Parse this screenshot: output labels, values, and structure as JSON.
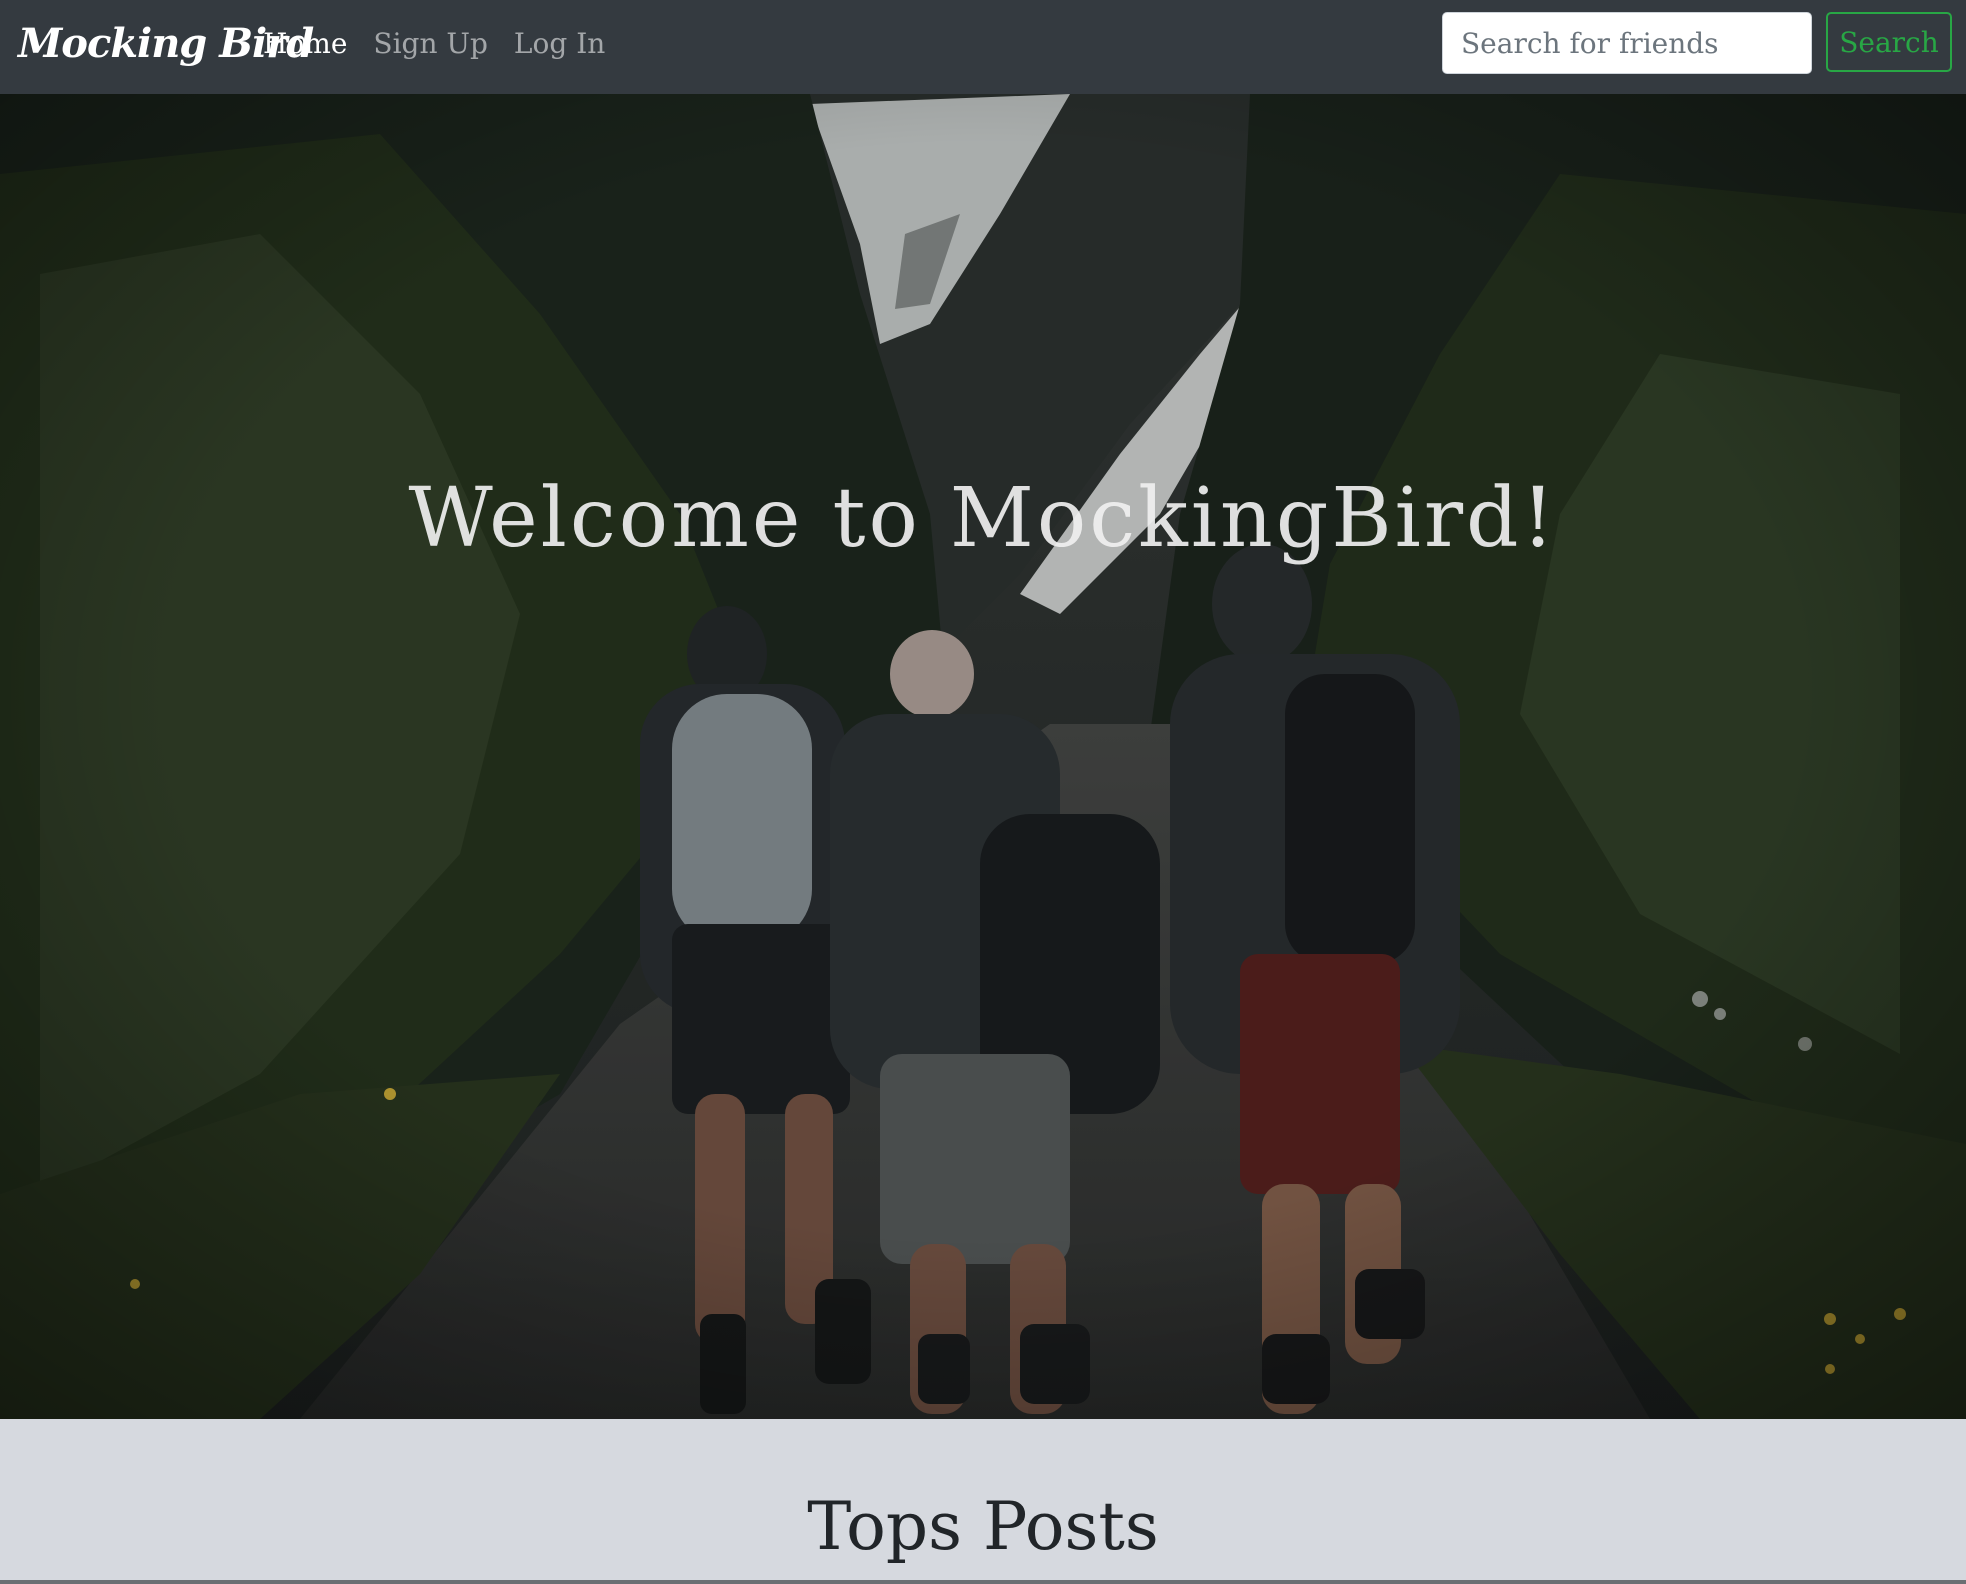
{
  "navbar": {
    "brand": "Mocking Bird",
    "links": [
      {
        "label": "Home",
        "active": true
      },
      {
        "label": "Sign Up",
        "active": false
      },
      {
        "label": "Log In",
        "active": false
      }
    ],
    "search": {
      "placeholder": "Search for friends",
      "value": "",
      "button_label": "Search"
    }
  },
  "hero": {
    "title": "Welcome to MockingBird!",
    "image": "photo of three hikers walking on a gravel forest trail"
  },
  "posts_section": {
    "title": "Tops Posts"
  },
  "colors": {
    "navbar_bg": "#343a40",
    "search_accent": "#28a745",
    "section_bg": "#d6d9df"
  }
}
